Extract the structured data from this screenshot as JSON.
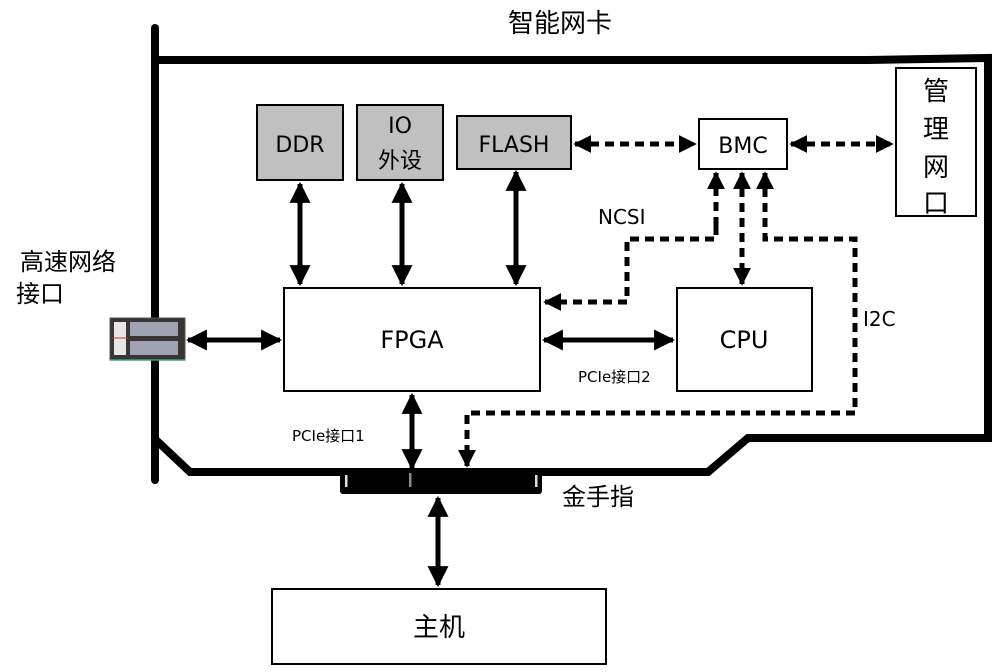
{
  "title": "智能网卡",
  "left_label": [
    "高速网络",
    "接口"
  ],
  "blocks": {
    "ddr": "DDR",
    "io": [
      "IO",
      "外设"
    ],
    "flash": "FLASH",
    "bmc": "BMC",
    "mgmt_port": [
      "管",
      "理",
      "网",
      "口"
    ],
    "fpga": "FPGA",
    "cpu": "CPU",
    "host": "主机"
  },
  "labels": {
    "ncsi": "NCSI",
    "i2c": "I2C",
    "pcie1": "PCIe接口1",
    "pcie2": "PCIe接口2",
    "gold_finger": "金手指"
  },
  "colors": {
    "peripheral_fill": "#c0c0c0",
    "box_fill": "#ffffff",
    "line": "#000000"
  }
}
